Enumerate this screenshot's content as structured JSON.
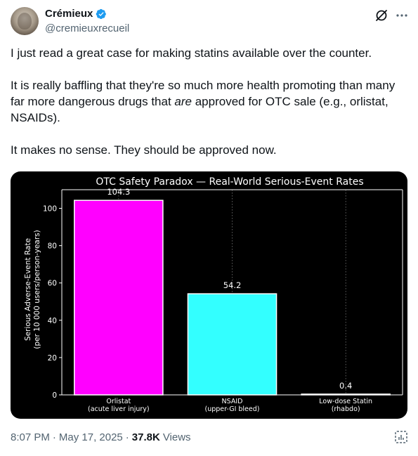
{
  "author": {
    "display_name": "Crémieux",
    "handle": "@cremieuxrecueil"
  },
  "tweet": {
    "p1": "I just read a great case for making statins available over the counter.",
    "p2_before": "It is really baffling that they're so much more health promoting than many far more dangerous drugs that ",
    "p2_em": "are",
    "p2_after": " approved for OTC sale (e.g., orlistat, NSAIDs).",
    "p3": "It makes no sense. They should be approved now."
  },
  "icons": {
    "verified": "verified-badge-icon",
    "grok": "grok-icon",
    "more": "more-icon",
    "analytics": "analytics-icon"
  },
  "chart_data": {
    "type": "bar",
    "title": "OTC Safety Paradox — Real-World Serious-Event Rates",
    "ylabel_line1": "Serious Adverse-Event Rate",
    "ylabel_line2": "(per 10 000 users/person-years)",
    "xlabel": "",
    "ylim": [
      0,
      110
    ],
    "yticks": [
      0,
      20,
      40,
      60,
      80,
      100
    ],
    "categories": [
      "Orlistat",
      "NSAID",
      "Low-dose Statin"
    ],
    "category_sublabels": [
      "(acute liver injury)",
      "(upper-GI bleed)",
      "(rhabdo)"
    ],
    "values": [
      104.3,
      54.2,
      0.4
    ],
    "value_labels": [
      "104.3",
      "54.2",
      "0.4"
    ],
    "colors": [
      "#ff00ff",
      "#33ffff",
      "#ffffff"
    ],
    "background": "#000000",
    "grid": "vertical dotted"
  },
  "footer": {
    "time": "8:07 PM",
    "sep1": "·",
    "date": "May 17, 2025",
    "sep2": "·",
    "views_count": "37.8K",
    "views_label": "Views"
  }
}
